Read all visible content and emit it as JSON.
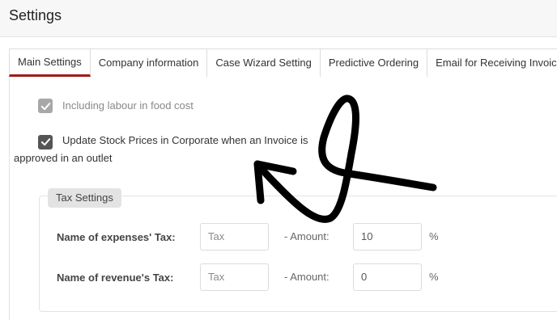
{
  "header": {
    "title": "Settings"
  },
  "tabs": [
    {
      "label": "Main Settings",
      "active": true
    },
    {
      "label": "Company information",
      "active": false
    },
    {
      "label": "Case Wizard Setting",
      "active": false
    },
    {
      "label": "Predictive Ordering",
      "active": false
    },
    {
      "label": "Email for Receiving Invoice",
      "active": false
    }
  ],
  "options": {
    "labour": {
      "label": "Including labour in food cost",
      "checked": true,
      "disabled": true
    },
    "stock_prices": {
      "label": "Update Stock Prices in Corporate when an Invoice is approved in an outlet",
      "checked": true,
      "disabled": false
    }
  },
  "tax_settings": {
    "legend": "Tax Settings",
    "rows": [
      {
        "label": "Name of expenses' Tax:",
        "name_value": "Tax",
        "amount_label": "- Amount:",
        "amount_value": "10",
        "unit": "%"
      },
      {
        "label": "Name of revenue's Tax:",
        "name_value": "Tax",
        "amount_label": "- Amount:",
        "amount_value": "0",
        "unit": "%"
      }
    ]
  },
  "colors": {
    "active_tab_accent": "#a01c1c",
    "checkbox_dark": "#555555",
    "checkbox_disabled": "#a8a8a8"
  }
}
